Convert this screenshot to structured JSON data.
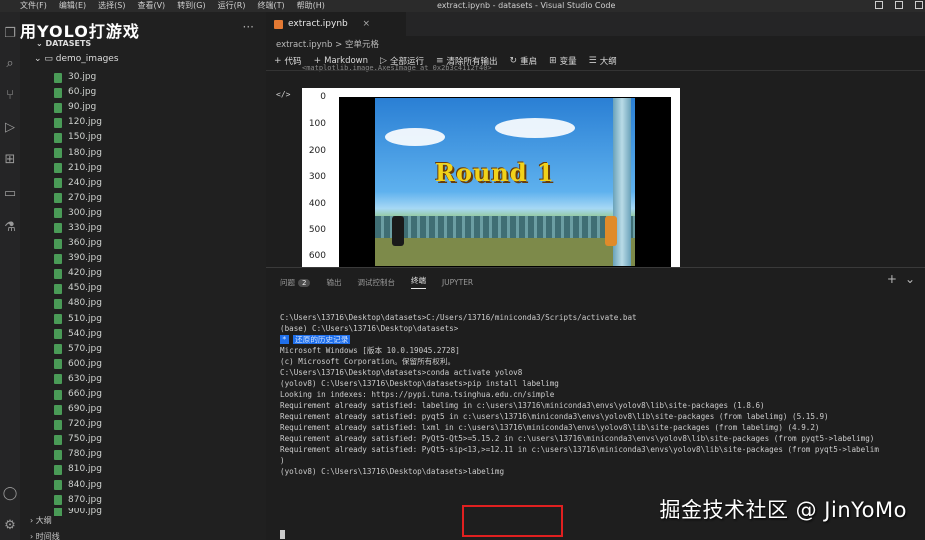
{
  "titlebar": {
    "menu": [
      "文件(F)",
      "编辑(E)",
      "选择(S)",
      "查看(V)",
      "转到(G)",
      "运行(R)",
      "终端(T)",
      "帮助(H)"
    ],
    "title": "extract.ipynb - datasets - Visual Studio Code"
  },
  "sidebar": {
    "overlay_text": "用YOLO打游戏",
    "section": "DATASETS",
    "folder": "demo_images",
    "files": [
      "30.jpg",
      "60.jpg",
      "90.jpg",
      "120.jpg",
      "150.jpg",
      "180.jpg",
      "210.jpg",
      "240.jpg",
      "270.jpg",
      "300.jpg",
      "330.jpg",
      "360.jpg",
      "390.jpg",
      "420.jpg",
      "450.jpg",
      "480.jpg",
      "510.jpg",
      "540.jpg",
      "570.jpg",
      "600.jpg",
      "630.jpg",
      "660.jpg",
      "690.jpg",
      "720.jpg",
      "750.jpg",
      "780.jpg",
      "810.jpg",
      "840.jpg",
      "870.jpg",
      "900.jpg"
    ],
    "outline": "大纲",
    "timeline": "时间线"
  },
  "editor": {
    "tab_name": "extract.ipynb",
    "breadcrumb": "extract.ipynb > 空单元格",
    "toolbar": {
      "code": "代码",
      "markdown": "Markdown",
      "run_all": "全部运行",
      "clear_outputs": "清除所有输出",
      "restart": "重启",
      "variables": "变量",
      "outline": "大纲"
    },
    "truncated_output": "<matplotlib.image.AxesImage at 0x2b3c4112f40>",
    "plot_yticks": [
      "0",
      "100",
      "200",
      "300",
      "400",
      "500",
      "600"
    ],
    "game_text": "Round 1"
  },
  "panel": {
    "tabs": [
      "问题",
      "输出",
      "调试控制台",
      "终端",
      "JUPYTER"
    ],
    "problems_count": "2",
    "terminal_lines": [
      "C:\\Users\\13716\\Desktop\\datasets>C:/Users/13716/miniconda3/Scripts/activate.bat",
      "",
      "(base) C:\\Users\\13716\\Desktop\\datasets>",
      "",
      "",
      "Microsoft Windows [版本 10.0.19045.2728]",
      "(c) Microsoft Corporation。保留所有权利。",
      "",
      "C:\\Users\\13716\\Desktop\\datasets>conda activate yolov8",
      "",
      "(yolov8) C:\\Users\\13716\\Desktop\\datasets>pip install labelimg",
      "Looking in indexes: https://pypi.tuna.tsinghua.edu.cn/simple",
      "Requirement already satisfied: labelimg in c:\\users\\13716\\miniconda3\\envs\\yolov8\\lib\\site-packages (1.8.6)",
      "Requirement already satisfied: pyqt5 in c:\\users\\13716\\miniconda3\\envs\\yolov8\\lib\\site-packages (from labelimg) (5.15.9)",
      "Requirement already satisfied: lxml in c:\\users\\13716\\miniconda3\\envs\\yolov8\\lib\\site-packages (from labelimg) (4.9.2)",
      "Requirement already satisfied: PyQt5-Qt5>=5.15.2 in c:\\users\\13716\\miniconda3\\envs\\yolov8\\lib\\site-packages (from pyqt5->labelimg)",
      "Requirement already satisfied: PyQt5-sip<13,>=12.11 in c:\\users\\13716\\miniconda3\\envs\\yolov8\\lib\\site-packages (from pyqt5->labelim",
      ")",
      "",
      "(yolov8) C:\\Users\\13716\\Desktop\\datasets>labelimg"
    ],
    "history_restored": "还原的历史记录"
  },
  "watermark": "掘金技术社区 @ JinYoMo"
}
